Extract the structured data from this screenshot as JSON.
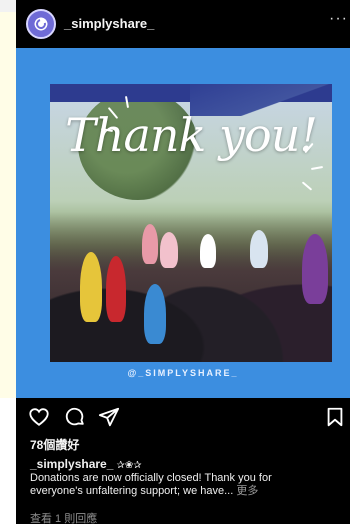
{
  "post": {
    "username": "_simplyshare_",
    "more_glyph": "···"
  },
  "media": {
    "overlay_text": "Thank you!",
    "watermark": "@_SIMPLYSHARE_",
    "colors": {
      "frame": "#3c8ee0"
    }
  },
  "actions": {
    "like_icon": "heart-icon",
    "comment_icon": "comment-icon",
    "share_icon": "send-icon",
    "save_icon": "bookmark-icon"
  },
  "stats": {
    "likes": "78個讚好"
  },
  "caption": {
    "username": "_simplyshare_",
    "emoji": "✰❀✰",
    "line1": "Donations are now officially closed! Thank you for",
    "line2": "everyone's unfaltering support; we have...",
    "more_label": "更多"
  },
  "comments": {
    "view_label": "查看 1 則回應"
  }
}
